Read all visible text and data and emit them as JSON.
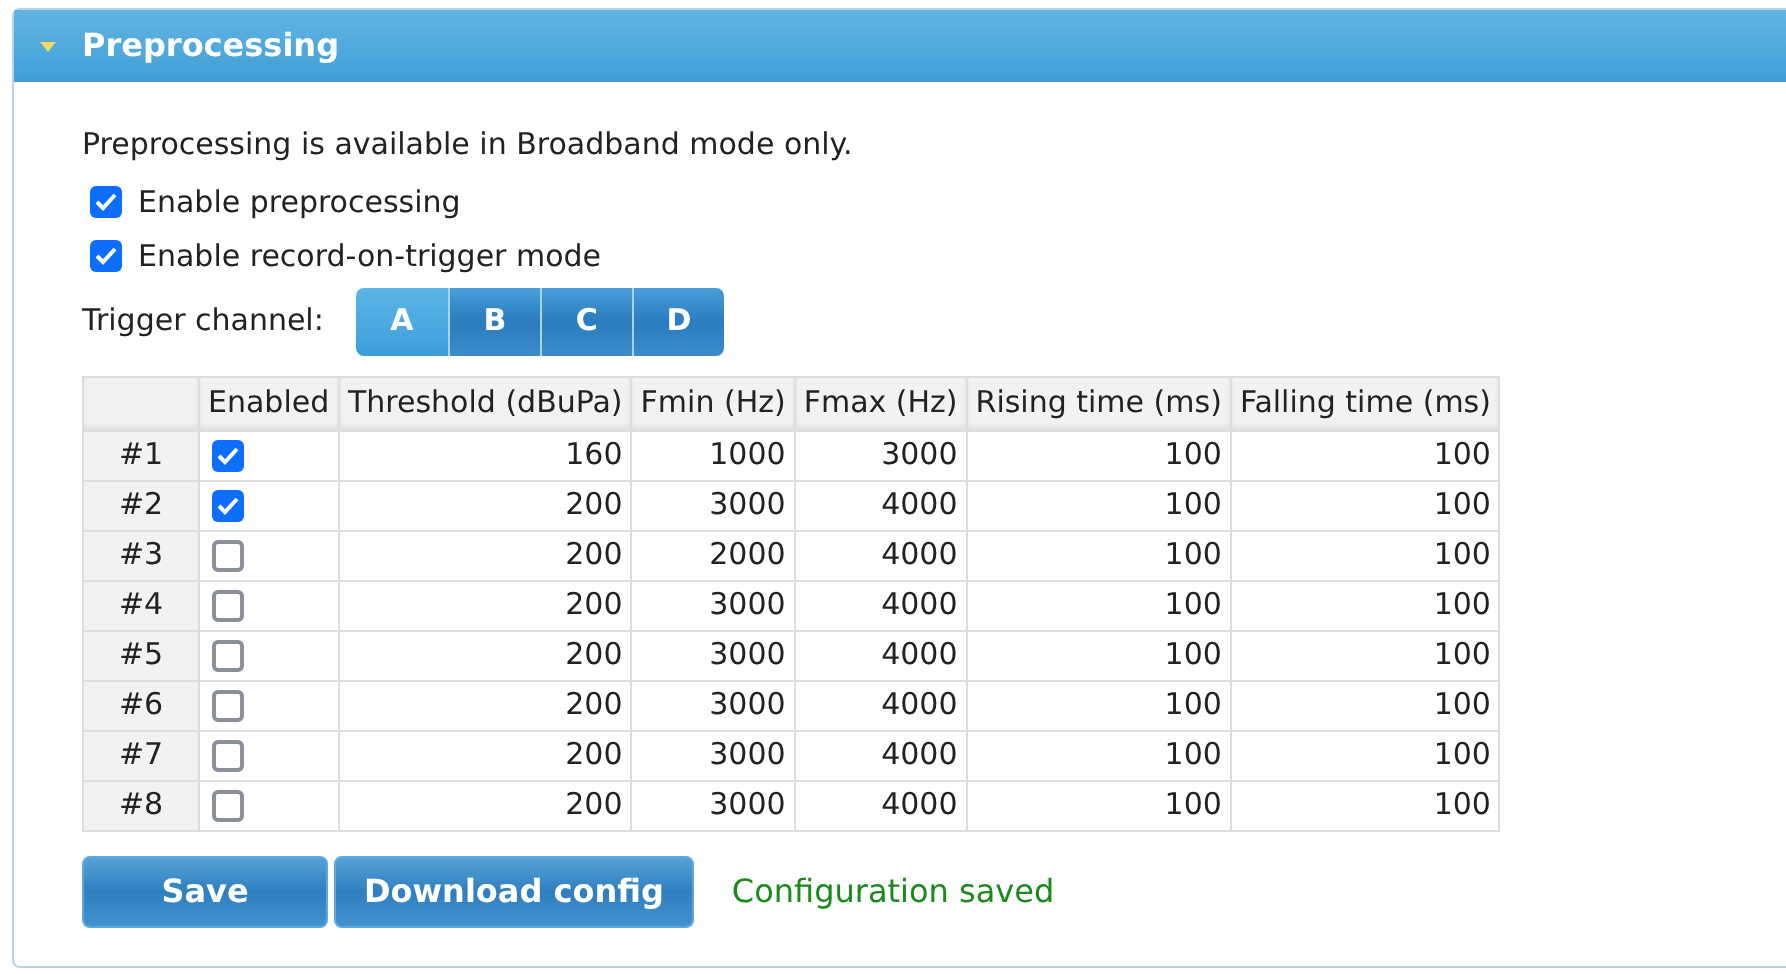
{
  "panel": {
    "title": "Preprocessing",
    "expanded": true
  },
  "note": "Preprocessing is available in Broadband mode only.",
  "options": [
    {
      "label": "Enable preprocessing",
      "checked": true
    },
    {
      "label": "Enable record-on-trigger mode",
      "checked": true
    }
  ],
  "trigger": {
    "label": "Trigger channel:",
    "channels": [
      {
        "label": "A",
        "selected": true
      },
      {
        "label": "B",
        "selected": false
      },
      {
        "label": "C",
        "selected": false
      },
      {
        "label": "D",
        "selected": false
      }
    ]
  },
  "table": {
    "columns": [
      "Enabled",
      "Threshold (dBuPa)",
      "Fmin (Hz)",
      "Fmax (Hz)",
      "Rising time (ms)",
      "Falling time (ms)"
    ],
    "rows": [
      {
        "label": "#1",
        "cells": [
          {
            "checked": true
          },
          "160",
          "1000",
          "3000",
          "100",
          "100"
        ]
      },
      {
        "label": "#2",
        "cells": [
          {
            "checked": true
          },
          "200",
          "3000",
          "4000",
          "100",
          "100"
        ]
      },
      {
        "label": "#3",
        "cells": [
          {
            "checked": false
          },
          "200",
          "2000",
          "4000",
          "100",
          "100"
        ]
      },
      {
        "label": "#4",
        "cells": [
          {
            "checked": false
          },
          "200",
          "3000",
          "4000",
          "100",
          "100"
        ]
      },
      {
        "label": "#5",
        "cells": [
          {
            "checked": false
          },
          "200",
          "3000",
          "4000",
          "100",
          "100"
        ]
      },
      {
        "label": "#6",
        "cells": [
          {
            "checked": false
          },
          "200",
          "3000",
          "4000",
          "100",
          "100"
        ]
      },
      {
        "label": "#7",
        "cells": [
          {
            "checked": false
          },
          "200",
          "3000",
          "4000",
          "100",
          "100"
        ]
      },
      {
        "label": "#8",
        "cells": [
          {
            "checked": false
          },
          "200",
          "3000",
          "4000",
          "100",
          "100"
        ]
      }
    ]
  },
  "buttons": [
    "Save",
    "Download config"
  ],
  "status": "Configuration saved"
}
